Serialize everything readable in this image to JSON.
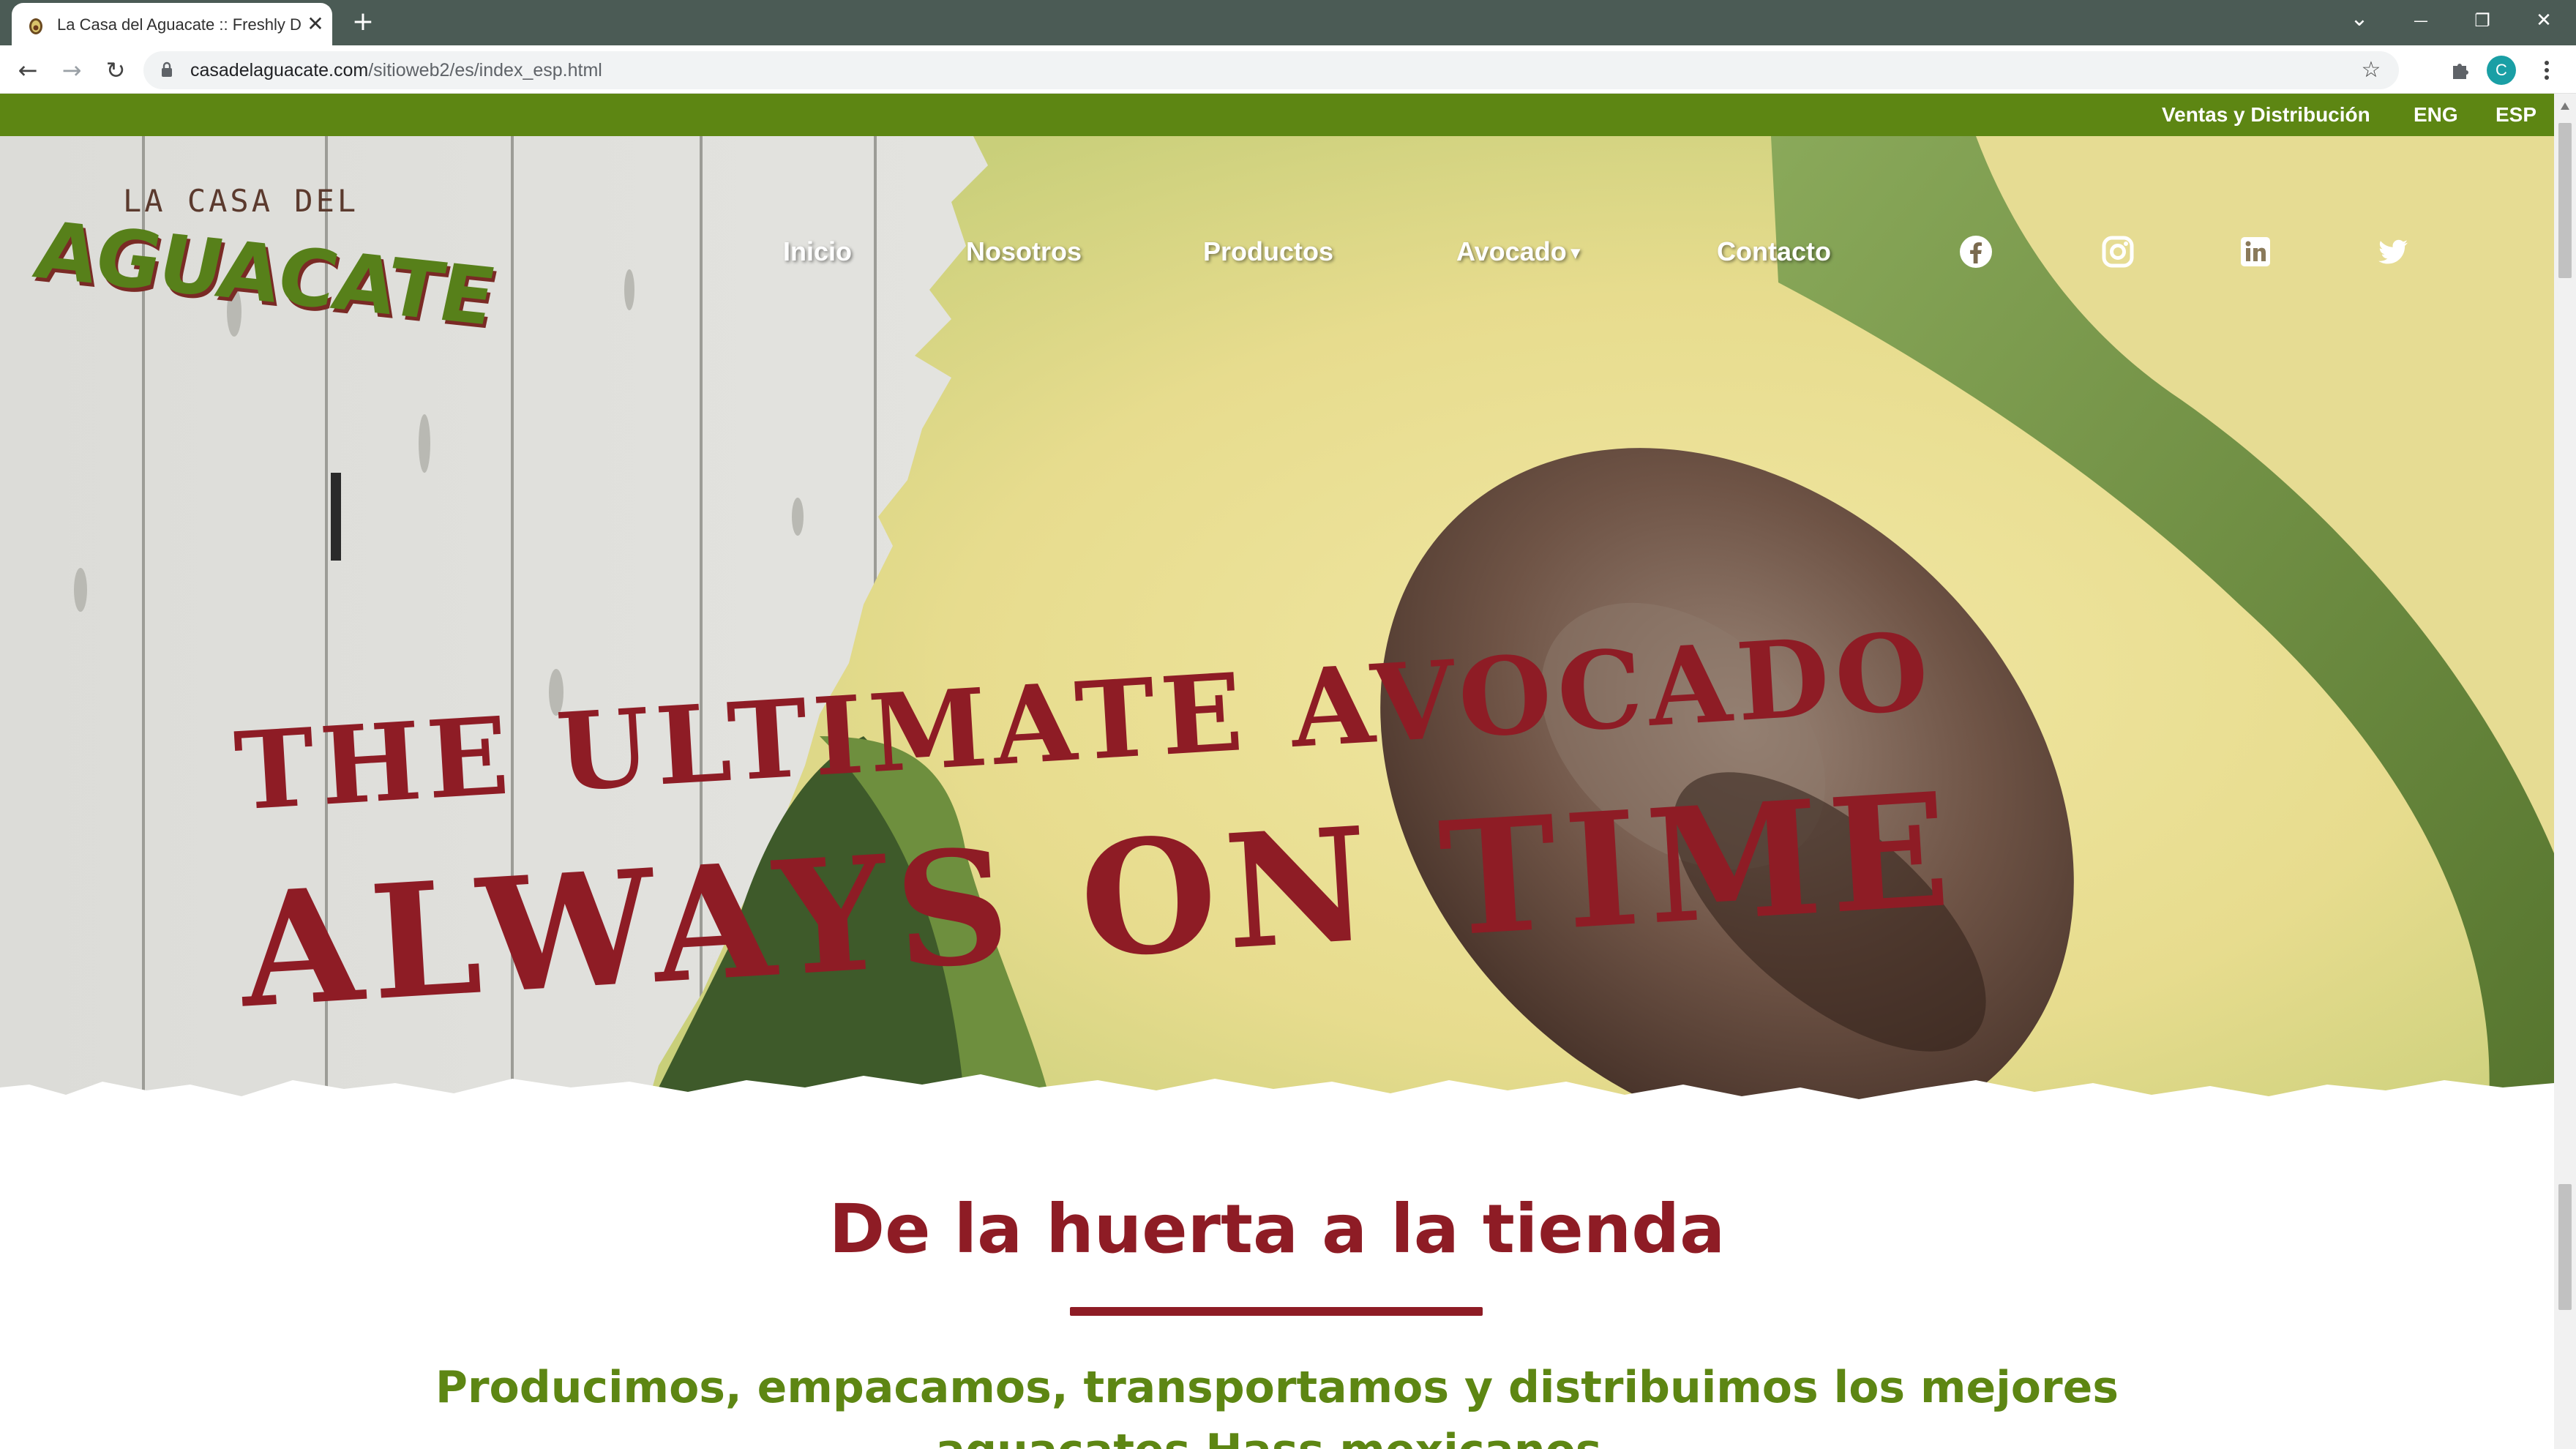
{
  "browser": {
    "tab_title": "La Casa del Aguacate :: Freshly D",
    "tab_close": "✕",
    "new_tab": "+",
    "url_host": "casadelaguacate.com",
    "url_path": "/sitioweb2/es/index_esp.html",
    "profile_initial": "C",
    "window_controls": {
      "dropdown": "⌄",
      "minimize": "—",
      "restore": "❐",
      "close": "✕"
    },
    "nav": {
      "back": "←",
      "forward": "→",
      "reload": "↻",
      "bookmark": "☆"
    }
  },
  "topbar": {
    "sales": "Ventas y Distribución",
    "eng": "ENG",
    "esp": "ESP"
  },
  "logo": {
    "line1": "LA CASA DEL",
    "line2": "AGUACATE"
  },
  "menu": {
    "inicio": "Inicio",
    "nosotros": "Nosotros",
    "productos": "Productos",
    "avocado": "Avocado",
    "contacto": "Contacto"
  },
  "social_icons": [
    "facebook-icon",
    "instagram-icon",
    "linkedin-icon",
    "twitter-icon"
  ],
  "hero": {
    "line1": "THE ULTIMATE AVOCADO",
    "line2": "ALWAYS ON TIME"
  },
  "content": {
    "title": "De la huerta a la tienda",
    "subtitle": "Producimos, empacamos, transportamos y distribuimos los mejores",
    "subtitle_cont": "aguacates Hass mexicanos."
  },
  "colors": {
    "topbar_green": "#5d8613",
    "brand_red": "#8e1c25",
    "brand_green": "#57801a",
    "chrome_frame": "#4b5b55"
  }
}
